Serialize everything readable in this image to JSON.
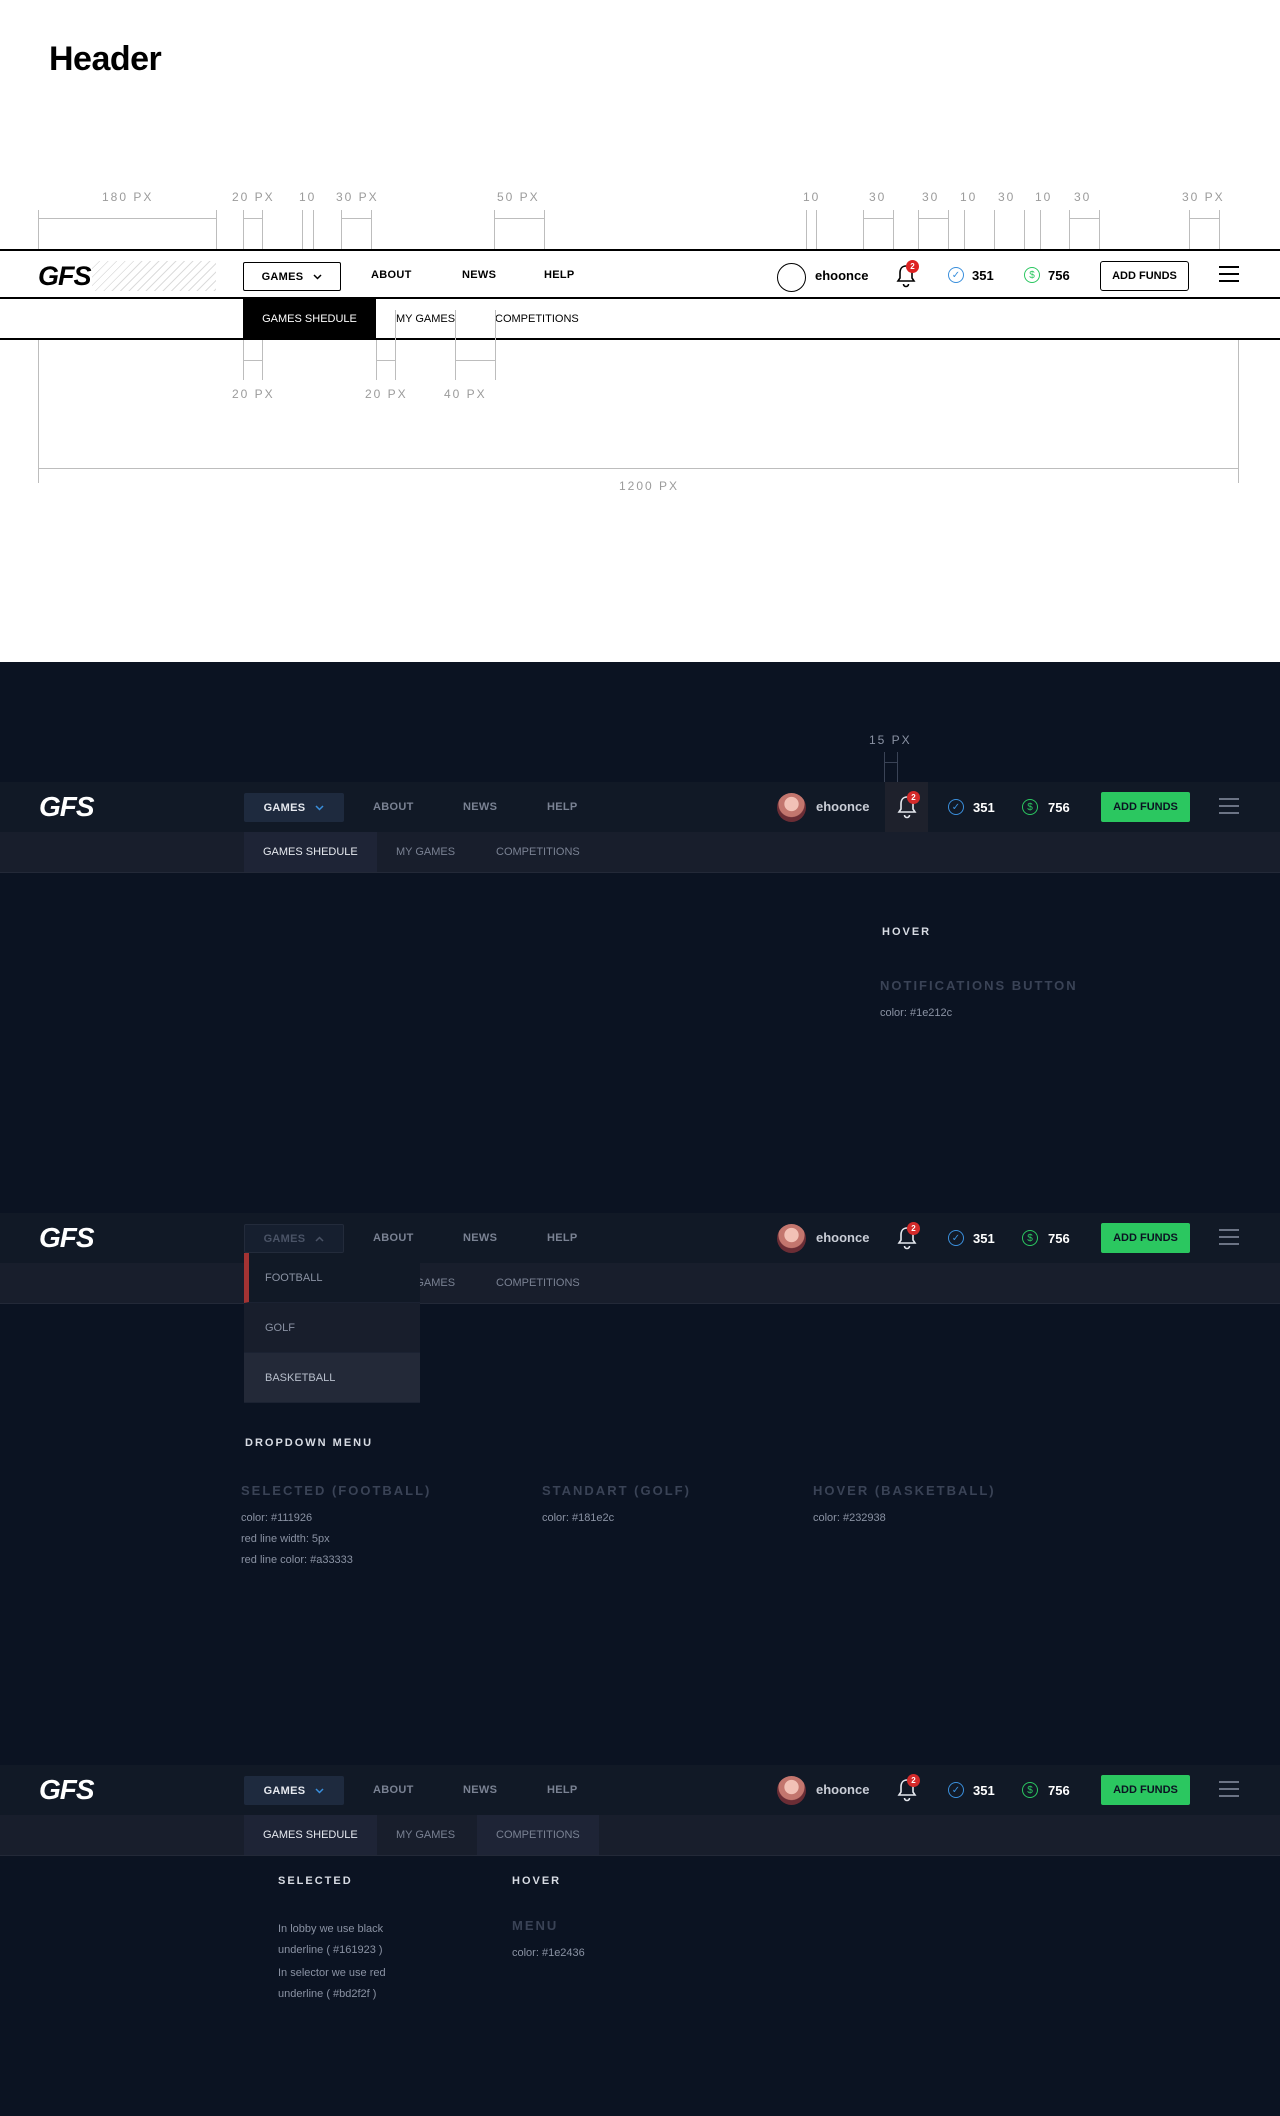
{
  "page_title": "Header",
  "dimensions": {
    "logo_width": "180 PX",
    "games_gap": "20 PX",
    "games_arrow_gap": "10",
    "about_gap": "30 PX",
    "nav_gap": "50 PX",
    "right_gap_1": "10",
    "right_gap_2": "30",
    "right_gap_3": "30",
    "right_gap_4": "10",
    "right_gap_5": "30",
    "right_gap_6": "10",
    "right_gap_7": "30",
    "right_gap_8": "30 PX",
    "sub_gap_left": "20 PX",
    "sub_gap_mid": "20 PX",
    "sub_gap_right": "40 PX",
    "total_width": "1200 PX",
    "bell_width": "15 PX"
  },
  "header": {
    "logo": "GFS",
    "games_label": "GAMES",
    "nav": [
      "ABOUT",
      "NEWS",
      "HELP"
    ],
    "username": "ehoonce",
    "notification_count": "2",
    "points": "351",
    "balance": "756",
    "add_funds_label": "ADD FUNDS",
    "sub_nav": [
      "GAMES SHEDULE",
      "MY GAMES",
      "COMPETITIONS"
    ]
  },
  "hover_section": {
    "title": "HOVER",
    "name": "NOTIFICATIONS BUTTON",
    "color_note": "color: #1e212c"
  },
  "dropdown": {
    "items": [
      "FOOTBALL",
      "GOLF",
      "BASKETBALL"
    ],
    "title": "DROPDOWN MENU",
    "selected_title": "SELECTED (FOOTBALL)",
    "selected_notes": [
      "color: #111926",
      "red line width: 5px",
      "red line color: #a33333"
    ],
    "standart_title": "STANDART (GOLF)",
    "standart_note": "color: #181e2c",
    "hover_title": "HOVER (BASKETBALL)",
    "hover_note": "color: #232938"
  },
  "menu_section": {
    "selected_title": "SELECTED",
    "selected_note_1": "In lobby we use black\nunderline ( #161923 )",
    "selected_note_2": "In selector we use red\nunderline ( #bd2f2f )",
    "hover_title": "HOVER",
    "menu_title": "MENU",
    "menu_note": "color: #1e2436"
  },
  "colors": {
    "dark_bg": "#0b1322",
    "header_bg": "#111926",
    "subheader_bg": "#181e2c",
    "accent_green": "#2bc760",
    "badge_red": "#d42a2a",
    "points_blue": "#3a8fdc"
  },
  "icons": [
    "chevron-down-icon",
    "chevron-up-icon",
    "bell-icon",
    "check-circle-icon",
    "dollar-circle-icon",
    "hamburger-menu-icon"
  ]
}
